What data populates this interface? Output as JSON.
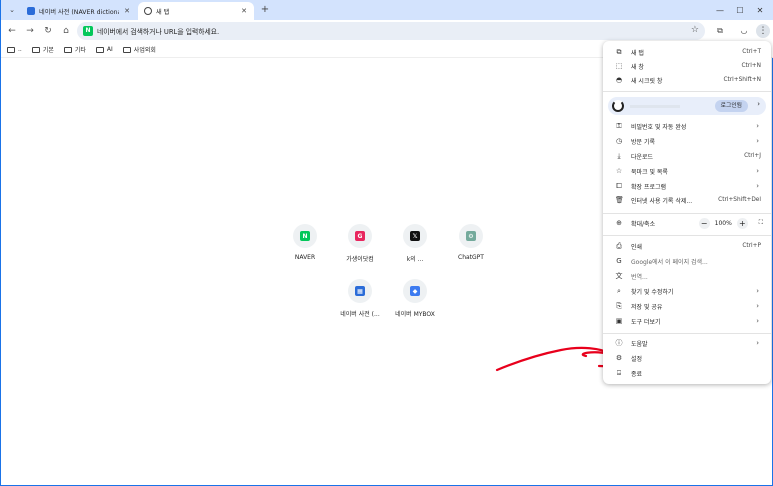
{
  "tabs": [
    {
      "title": "네이버 사전 (NAVER dictionary)",
      "active": false
    },
    {
      "title": "새 탭",
      "active": true
    }
  ],
  "window_controls": {
    "minimize": "—",
    "maximize": "☐",
    "close": "✕"
  },
  "toolbar": {
    "omnibox_placeholder": "네이버에서 검색하거나 URL을 입력하세요.",
    "favicon_letter": "N"
  },
  "bookmarks": [
    {
      "label": ".."
    },
    {
      "label": "기본"
    },
    {
      "label": "기타"
    },
    {
      "label": "AI"
    },
    {
      "label": "사업외회"
    }
  ],
  "shortcuts": [
    {
      "label": "NAVER",
      "icon": "naver-icon",
      "glyph": "N",
      "color": "#03c75a"
    },
    {
      "label": "가생이닷컴",
      "icon": "gasengi-icon",
      "glyph": "G",
      "color": "#e8265e"
    },
    {
      "label": "k의 ...",
      "icon": "x-icon",
      "glyph": "𝕏",
      "color": "#111111"
    },
    {
      "label": "ChatGPT",
      "icon": "chatgpt-icon",
      "glyph": "⚙",
      "color": "#74aa9c"
    },
    {
      "label": "네이버 사전 (...",
      "icon": "naver-dict-icon",
      "glyph": "▦",
      "color": "#2b6cd8"
    },
    {
      "label": "네이버 MYBOX",
      "icon": "mybox-icon",
      "glyph": "◆",
      "color": "#3d7bf0"
    }
  ],
  "menu": {
    "items_top": [
      {
        "label": "새 탭",
        "shortcut": "Ctrl+T",
        "icon": "new-tab-icon"
      },
      {
        "label": "새 창",
        "shortcut": "Ctrl+N",
        "icon": "new-window-icon"
      },
      {
        "label": "새 시크릿 창",
        "shortcut": "Ctrl+Shift+N",
        "icon": "incognito-icon"
      }
    ],
    "profile_login": "로그인됨",
    "items_mid": [
      {
        "label": "비밀번호 및 자동 완성",
        "shortcut": "",
        "arrow": true,
        "icon": "key-icon"
      },
      {
        "label": "방문 기록",
        "shortcut": "",
        "arrow": true,
        "icon": "history-icon"
      },
      {
        "label": "다운로드",
        "shortcut": "Ctrl+J",
        "arrow": false,
        "icon": "download-icon"
      },
      {
        "label": "북마크 및 목록",
        "shortcut": "",
        "arrow": true,
        "icon": "star-icon"
      },
      {
        "label": "확장 프로그램",
        "shortcut": "",
        "arrow": true,
        "icon": "extension-icon"
      },
      {
        "label": "인터넷 사용 기록 삭제...",
        "shortcut": "Ctrl+Shift+Del",
        "arrow": false,
        "icon": "trash-icon"
      }
    ],
    "zoom": {
      "label": "확대/축소",
      "value": "100%",
      "minus": "−",
      "plus": "+"
    },
    "items_lower": [
      {
        "label": "인쇄",
        "shortcut": "Ctrl+P",
        "arrow": false,
        "icon": "print-icon",
        "dim": false
      },
      {
        "label": "Google에서 이 페이지 검색...",
        "shortcut": "",
        "arrow": false,
        "icon": "google-icon",
        "dim": true
      },
      {
        "label": "번역...",
        "shortcut": "",
        "arrow": false,
        "icon": "translate-icon",
        "dim": true
      },
      {
        "label": "찾기 및 수정하기",
        "shortcut": "",
        "arrow": true,
        "icon": "find-icon",
        "dim": false
      },
      {
        "label": "저장 및 공유",
        "shortcut": "",
        "arrow": true,
        "icon": "share-icon",
        "dim": false
      },
      {
        "label": "도구 더보기",
        "shortcut": "",
        "arrow": true,
        "icon": "toolbox-icon",
        "dim": false
      }
    ],
    "items_bottom": [
      {
        "label": "도움말",
        "shortcut": "",
        "arrow": true,
        "icon": "help-icon"
      },
      {
        "label": "설정",
        "shortcut": "",
        "arrow": false,
        "icon": "settings-icon"
      },
      {
        "label": "종료",
        "shortcut": "",
        "arrow": false,
        "icon": "exit-icon"
      }
    ]
  },
  "annotation_color": "#e8001c"
}
